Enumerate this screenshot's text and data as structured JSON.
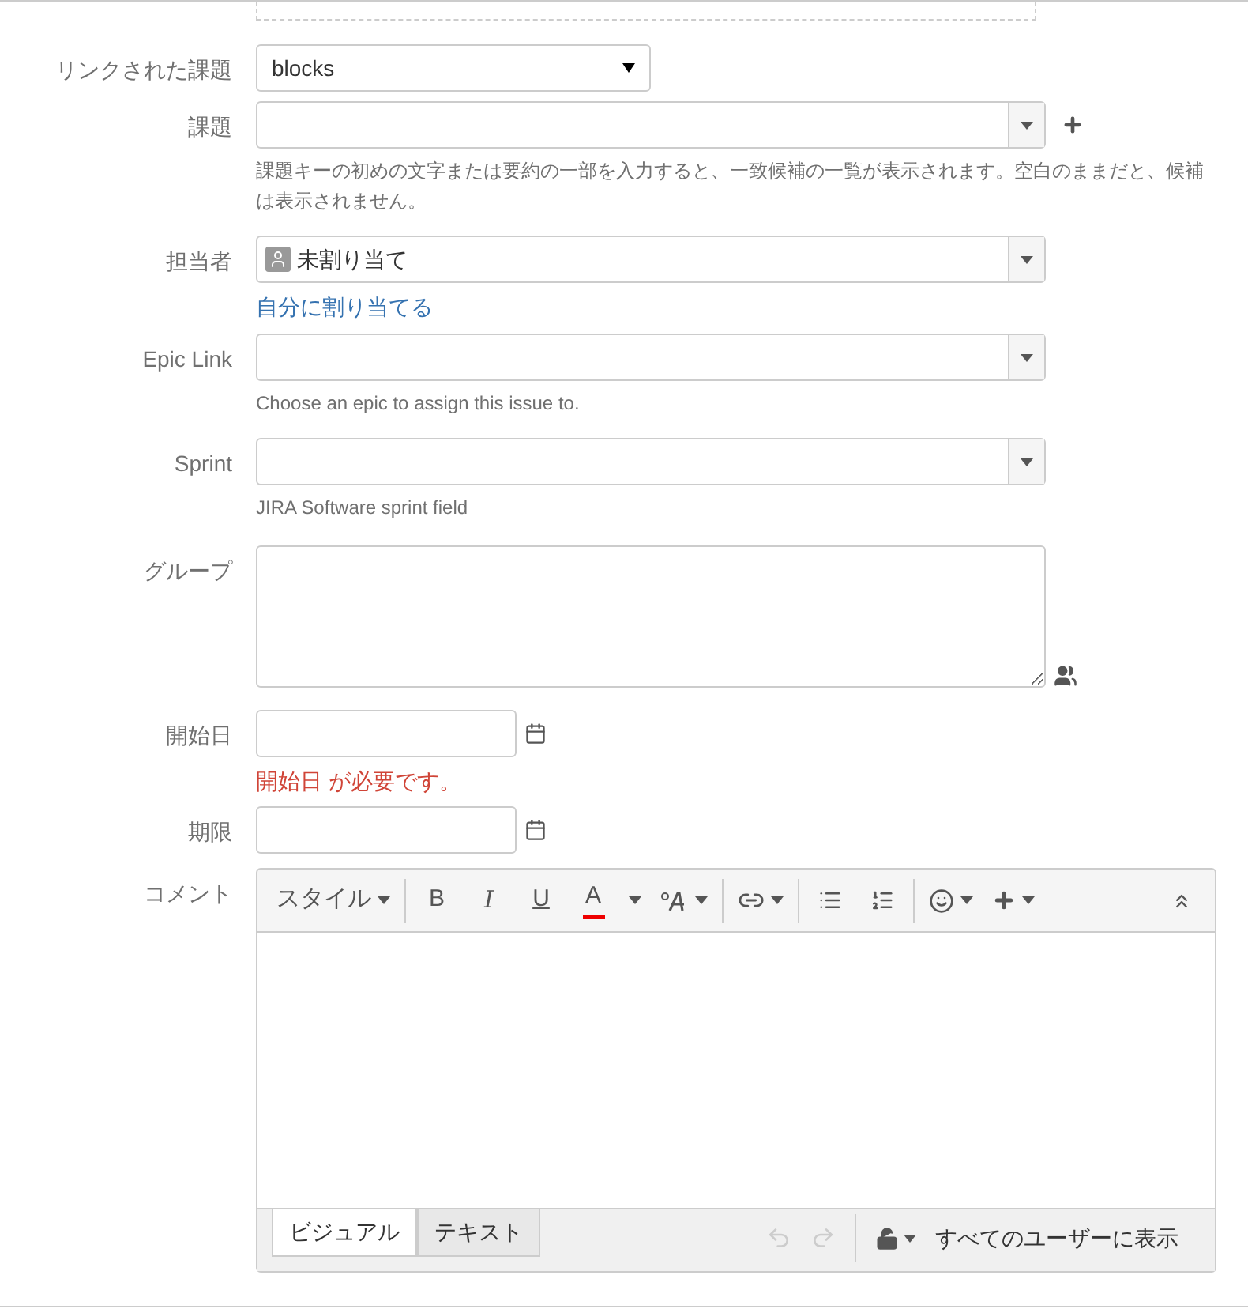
{
  "fields": [
    {
      "kind": "select",
      "label": "リンクされた課題",
      "value": "blocks"
    },
    {
      "kind": "combo-add",
      "label": "課題",
      "help": "課題キーの初めの文字または要約の一部を入力すると、一致候補の一覧が表示されます。空白のままだと、候補は表示されません。"
    },
    {
      "kind": "user-picker",
      "label": "担当者",
      "value": "未割り当て",
      "link": "自分に割り当てる"
    },
    {
      "kind": "combo",
      "label": "Epic Link",
      "help": "Choose an epic to assign this issue to."
    },
    {
      "kind": "combo",
      "label": "Sprint",
      "help": "JIRA Software sprint field"
    },
    {
      "kind": "group-textarea",
      "label": "グループ"
    },
    {
      "kind": "date",
      "label": "開始日",
      "error": "開始日 が必要です。"
    },
    {
      "kind": "date",
      "label": "期限"
    }
  ],
  "comment": {
    "label": "コメント",
    "toolbar": [
      {
        "kind": "style",
        "label": "スタイル"
      },
      {
        "kind": "sep"
      },
      {
        "kind": "bold",
        "label": "B"
      },
      {
        "kind": "italic",
        "label": "I"
      },
      {
        "kind": "underline",
        "label": "U"
      },
      {
        "kind": "color",
        "label": "A"
      },
      {
        "kind": "caret"
      },
      {
        "kind": "format"
      },
      {
        "kind": "sep"
      },
      {
        "kind": "link"
      },
      {
        "kind": "sep"
      },
      {
        "kind": "bullets"
      },
      {
        "kind": "numbers"
      },
      {
        "kind": "sep"
      },
      {
        "kind": "emoji"
      },
      {
        "kind": "insert"
      }
    ],
    "tabs": [
      {
        "label": "ビジュアル",
        "selected": true
      },
      {
        "label": "テキスト",
        "selected": false
      }
    ],
    "undo_disabled": true,
    "redo_disabled": true,
    "visibility": "すべてのユーザーに表示"
  }
}
